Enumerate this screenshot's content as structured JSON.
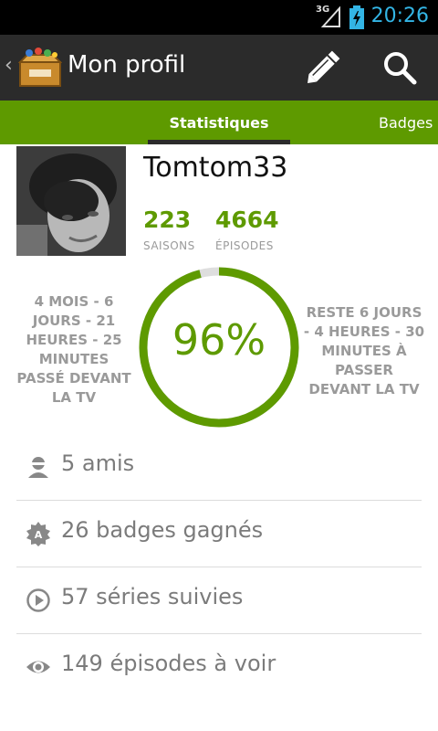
{
  "status_bar": {
    "network": "3G",
    "time": "20:26"
  },
  "action_bar": {
    "title": "Mon profil",
    "icons": [
      "back-chevron-icon",
      "app-logo-icon",
      "pencil-icon",
      "search-icon"
    ]
  },
  "tabs": [
    {
      "label": "Statistiques",
      "selected": true
    },
    {
      "label": "Badges",
      "selected": false
    }
  ],
  "profile": {
    "username": "Tomtom33",
    "seasons": {
      "value": "223",
      "label": "SAISONS"
    },
    "episodes": {
      "value": "4664",
      "label": "ÉPISODES"
    }
  },
  "progress": {
    "percent_label": "96%",
    "percent_value": 0.96,
    "time_spent": "4 MOIS - 6 JOURS - 21 HEURES - 25 MINUTES PASSÉ DEVANT LA TV",
    "time_remaining": "RESTE 6 JOURS - 4 HEURES - 30 MINUTES À PASSER DEVANT LA TV"
  },
  "list": [
    {
      "icon": "person-icon",
      "label": "5 amis"
    },
    {
      "icon": "badge-icon",
      "label": "26 badges gagnés"
    },
    {
      "icon": "play-circle-icon",
      "label": "57 séries suivies"
    },
    {
      "icon": "eye-icon",
      "label": "149 épisodes à voir"
    }
  ],
  "colors": {
    "accent": "#5e9a00",
    "actionbar": "#2b2b2b",
    "status_accent": "#33b5e5"
  }
}
